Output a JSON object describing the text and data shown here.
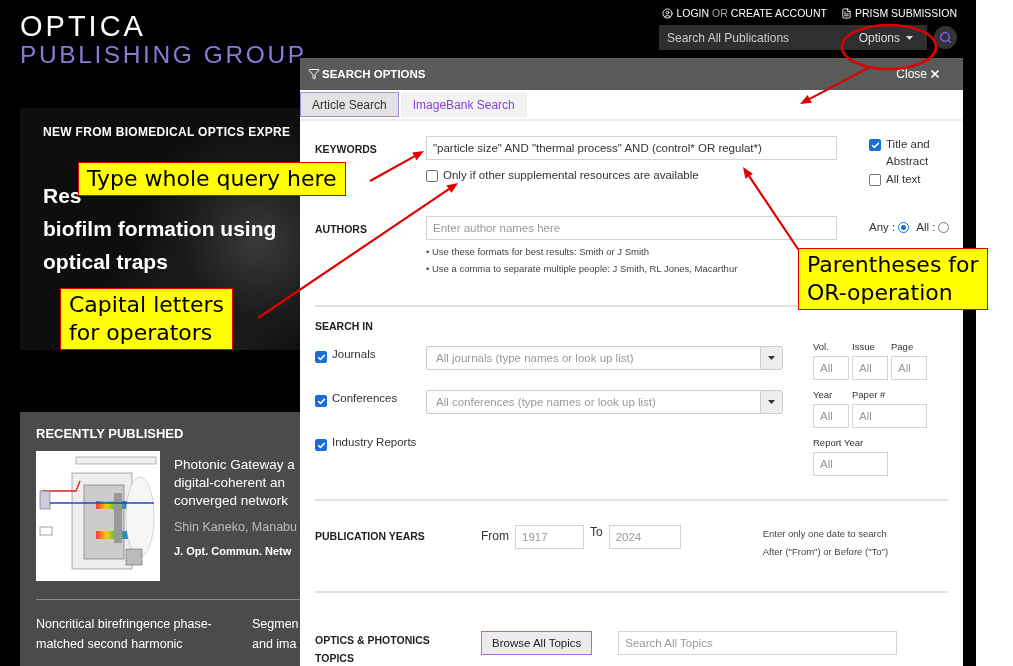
{
  "header": {
    "logo_top": "OPTICA",
    "logo_bottom": "PUBLISHING GROUP",
    "login": "LOGIN",
    "or": "OR",
    "create_account": "CREATE ACCOUNT",
    "submission": "PRISM SUBMISSION",
    "search_placeholder": "Search All Publications",
    "options_button": "Options"
  },
  "banner": {
    "kicker": "NEW FROM BIOMEDICAL OPTICS EXPRE",
    "headline_lines": [
      "Res",
      "biofilm formation using",
      "optical traps"
    ]
  },
  "recent": {
    "heading": "RECENTLY PUBLISHED",
    "featured": {
      "title_lines": [
        "Photonic Gateway a",
        "digital-coherent an",
        "converged network"
      ],
      "authors": "Shin Kaneko, Manabu",
      "journal": "J. Opt. Commun. Netw"
    },
    "items": [
      {
        "lines": [
          "Noncritical birefringence phase-",
          "matched second harmonic"
        ]
      },
      {
        "lines": [
          "Segmen",
          "and ima"
        ]
      }
    ]
  },
  "search_options": {
    "title": "SEARCH OPTIONS",
    "close": "Close",
    "tabs": [
      {
        "label": "Article Search",
        "selected": true
      },
      {
        "label": "ImageBank Search",
        "selected": false
      }
    ],
    "keywords": {
      "label": "KEYWORDS",
      "value": "\"particle size\" AND \"thermal process\" AND (control* OR regulat*)",
      "supplemental": {
        "label": "Only if other supplemental resources are available",
        "checked": false
      }
    },
    "scope": [
      {
        "label": "Title and Abstract",
        "checked": true
      },
      {
        "label": "All text",
        "checked": false
      }
    ],
    "authors": {
      "label": "AUTHORS",
      "placeholder": "Enter author names here",
      "hints": [
        "• Use these formats for best results: Smith or J Smith",
        "• Use a comma to separate multiple people: J Smith, RL Jones, Macarthur"
      ]
    },
    "match": [
      {
        "label": "Any :",
        "selected": true
      },
      {
        "label": "All :",
        "selected": false
      }
    ],
    "search_in": {
      "label": "SEARCH IN",
      "sources": [
        {
          "label": "Journals",
          "checked": true,
          "placeholder": "All journals (type names or look up list)"
        },
        {
          "label": "Conferences",
          "checked": true,
          "placeholder": "All conferences (type names or look up list)"
        },
        {
          "label": "Industry Reports",
          "checked": true
        }
      ],
      "citation_rows": [
        [
          {
            "label": "Vol.",
            "placeholder": "All"
          },
          {
            "label": "Issue",
            "placeholder": "All"
          },
          {
            "label": "Page",
            "placeholder": "All"
          }
        ],
        [
          {
            "label": "Year",
            "placeholder": "All"
          },
          {
            "label": "Paper #",
            "placeholder": "All"
          }
        ],
        [
          {
            "label": "Report Year",
            "placeholder": "All"
          }
        ]
      ]
    },
    "publication_years": {
      "label": "PUBLICATION YEARS",
      "from_label": "From",
      "from_placeholder": "1917",
      "to_label": "To",
      "to_placeholder": "2024",
      "hints": [
        "Enter only one date to search",
        "After (\"From\") or Before (\"To\")"
      ]
    },
    "topics": {
      "label_lines": [
        "OPTICS & PHOTONICS",
        "TOPICS"
      ],
      "browse_button": "Browse All Topics",
      "search_placeholder": "Search All Topics"
    }
  },
  "annotations": {
    "callouts": [
      {
        "lines": [
          "Type whole query here"
        ]
      },
      {
        "lines": [
          "Capital letters",
          "for operators"
        ]
      },
      {
        "lines": [
          "Parentheses for",
          "OR-operation"
        ]
      }
    ]
  }
}
